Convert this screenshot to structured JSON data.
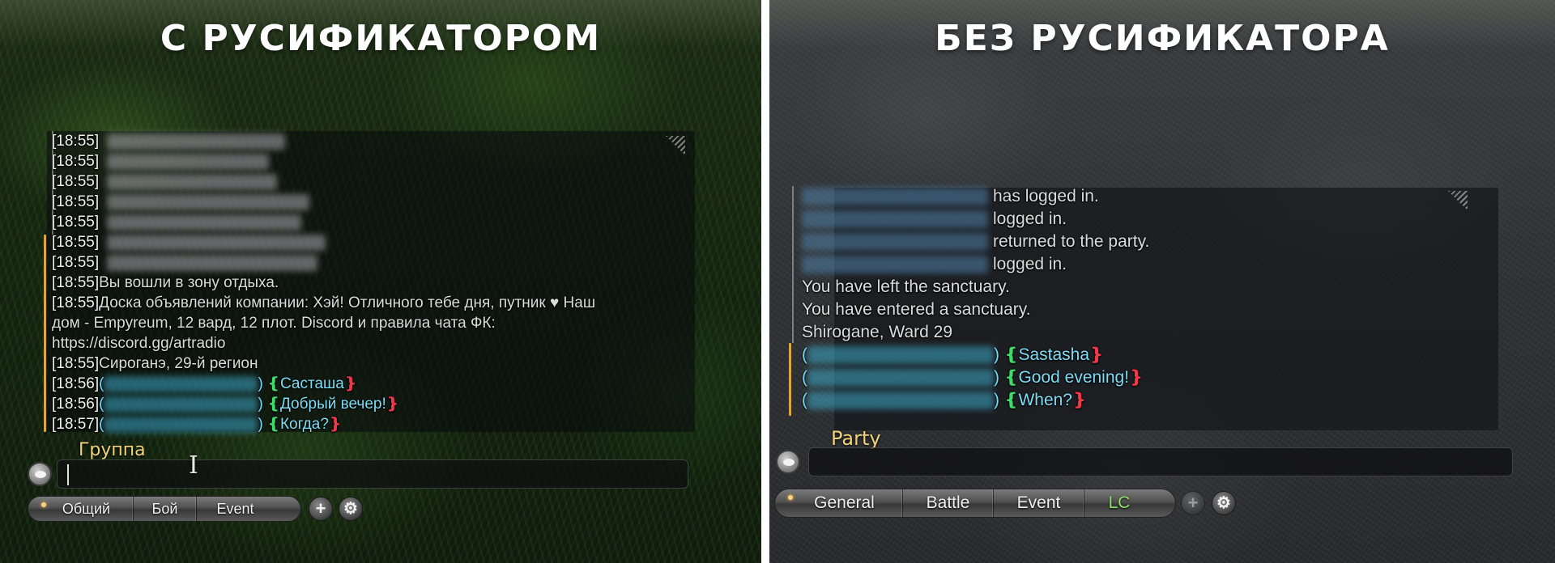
{
  "left": {
    "heading": "С РУСИФИКАТОРОМ",
    "chat": {
      "lines": [
        {
          "ts": "[18:55]",
          "kind": "blur",
          "blur_width": 220
        },
        {
          "ts": "[18:55]",
          "kind": "blur",
          "blur_width": 200
        },
        {
          "ts": "[18:55]",
          "kind": "blur",
          "blur_width": 210
        },
        {
          "ts": "[18:55]",
          "kind": "blur",
          "blur_width": 250
        },
        {
          "ts": "[18:55]",
          "kind": "blur",
          "blur_width": 240
        },
        {
          "ts": "[18:55]",
          "kind": "blur",
          "blur_width": 270
        },
        {
          "ts": "[18:55]",
          "kind": "blur",
          "blur_width": 260
        },
        {
          "ts": "[18:55]",
          "kind": "text",
          "text": "Вы вошли в зону отдыха."
        },
        {
          "ts": "[18:55]",
          "kind": "text",
          "text": "Доска объявлений компании: Хэй! Отличного тебе дня, путник ♥ Наш"
        },
        {
          "ts": "",
          "kind": "text",
          "text": "дом - Empyreum, 12 вард, 12 плот. Discord и правила чата ФК:"
        },
        {
          "ts": "",
          "kind": "text",
          "text": "https://discord.gg/artradio"
        },
        {
          "ts": "[18:55]",
          "kind": "text",
          "text": "Сироганэ, 29-й регион"
        },
        {
          "ts": "[18:56]",
          "kind": "party",
          "text": "Састаша",
          "blur_width": 190
        },
        {
          "ts": "[18:56]",
          "kind": "party",
          "text": "Добрый вечер!",
          "blur_width": 190
        },
        {
          "ts": "[18:57]",
          "kind": "party",
          "text": "Когда?",
          "blur_width": 190
        }
      ]
    },
    "channel_label": "Группа",
    "input": {
      "value": ""
    },
    "tabs": [
      {
        "label": "Общий",
        "active": true
      },
      {
        "label": "Бой",
        "active": false
      },
      {
        "label": "Event",
        "active": false
      }
    ],
    "buttons": {
      "add": "+",
      "settings": "⚙"
    }
  },
  "right": {
    "heading": "БЕЗ РУСИФИКАТОРА",
    "chat": {
      "lines": [
        {
          "kind": "blur-text",
          "text": "has logged in.",
          "blur_width": 230
        },
        {
          "kind": "blur-text",
          "text": "logged in.",
          "blur_width": 230
        },
        {
          "kind": "blur-text",
          "text": "returned to the party.",
          "blur_width": 230
        },
        {
          "kind": "blur-text",
          "text": "logged in.",
          "blur_width": 230
        },
        {
          "kind": "text",
          "text": "You have left the sanctuary."
        },
        {
          "kind": "text",
          "text": "You have entered a sanctuary."
        },
        {
          "kind": "text",
          "text": "Shirogane, Ward 29"
        },
        {
          "kind": "party",
          "text": "Sastasha",
          "blur_width": 230
        },
        {
          "kind": "party",
          "text": "Good evening!",
          "blur_width": 230
        },
        {
          "kind": "party",
          "text": "When?",
          "blur_width": 230
        }
      ]
    },
    "channel_label": "Party",
    "input": {
      "value": ""
    },
    "tabs": [
      {
        "label": "General",
        "active": true
      },
      {
        "label": "Battle",
        "active": false
      },
      {
        "label": "Event",
        "active": false
      },
      {
        "label": "LC",
        "active": false
      }
    ],
    "buttons": {
      "add": "+",
      "settings": "⚙"
    }
  },
  "colors": {
    "party_text": "#7fdcf4",
    "bracket_open": "#3fdb6a",
    "bracket_close": "#f0384a",
    "channel_label": "#f0d27a",
    "accent_bar": "#d9a640",
    "lc_tab": "#8ee06b"
  }
}
